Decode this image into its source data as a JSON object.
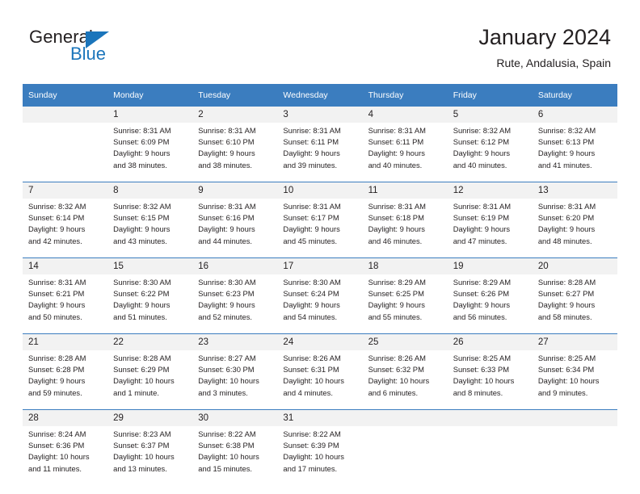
{
  "brand": {
    "name_part1": "General",
    "name_part2": "Blue",
    "triangle_color": "#1b75bb",
    "blue": "#1b75bb"
  },
  "header": {
    "title": "January 2024",
    "subtitle": "Rute, Andalusia, Spain"
  },
  "theme": {
    "header_bg": "#3b7dbf",
    "header_text": "#ffffff",
    "daynum_bg": "#f2f2f2",
    "divider": "#3b7dbf",
    "text": "#231f20"
  },
  "weekday_headers": [
    "Sunday",
    "Monday",
    "Tuesday",
    "Wednesday",
    "Thursday",
    "Friday",
    "Saturday"
  ],
  "weeks": [
    {
      "numbers": [
        "",
        "1",
        "2",
        "3",
        "4",
        "5",
        "6"
      ],
      "cells": [
        {
          "sunrise": "",
          "sunset": "",
          "daylight_line1": "",
          "daylight_line2": ""
        },
        {
          "sunrise": "Sunrise: 8:31 AM",
          "sunset": "Sunset: 6:09 PM",
          "daylight_line1": "Daylight: 9 hours",
          "daylight_line2": "and 38 minutes."
        },
        {
          "sunrise": "Sunrise: 8:31 AM",
          "sunset": "Sunset: 6:10 PM",
          "daylight_line1": "Daylight: 9 hours",
          "daylight_line2": "and 38 minutes."
        },
        {
          "sunrise": "Sunrise: 8:31 AM",
          "sunset": "Sunset: 6:11 PM",
          "daylight_line1": "Daylight: 9 hours",
          "daylight_line2": "and 39 minutes."
        },
        {
          "sunrise": "Sunrise: 8:31 AM",
          "sunset": "Sunset: 6:11 PM",
          "daylight_line1": "Daylight: 9 hours",
          "daylight_line2": "and 40 minutes."
        },
        {
          "sunrise": "Sunrise: 8:32 AM",
          "sunset": "Sunset: 6:12 PM",
          "daylight_line1": "Daylight: 9 hours",
          "daylight_line2": "and 40 minutes."
        },
        {
          "sunrise": "Sunrise: 8:32 AM",
          "sunset": "Sunset: 6:13 PM",
          "daylight_line1": "Daylight: 9 hours",
          "daylight_line2": "and 41 minutes."
        }
      ]
    },
    {
      "numbers": [
        "7",
        "8",
        "9",
        "10",
        "11",
        "12",
        "13"
      ],
      "cells": [
        {
          "sunrise": "Sunrise: 8:32 AM",
          "sunset": "Sunset: 6:14 PM",
          "daylight_line1": "Daylight: 9 hours",
          "daylight_line2": "and 42 minutes."
        },
        {
          "sunrise": "Sunrise: 8:32 AM",
          "sunset": "Sunset: 6:15 PM",
          "daylight_line1": "Daylight: 9 hours",
          "daylight_line2": "and 43 minutes."
        },
        {
          "sunrise": "Sunrise: 8:31 AM",
          "sunset": "Sunset: 6:16 PM",
          "daylight_line1": "Daylight: 9 hours",
          "daylight_line2": "and 44 minutes."
        },
        {
          "sunrise": "Sunrise: 8:31 AM",
          "sunset": "Sunset: 6:17 PM",
          "daylight_line1": "Daylight: 9 hours",
          "daylight_line2": "and 45 minutes."
        },
        {
          "sunrise": "Sunrise: 8:31 AM",
          "sunset": "Sunset: 6:18 PM",
          "daylight_line1": "Daylight: 9 hours",
          "daylight_line2": "and 46 minutes."
        },
        {
          "sunrise": "Sunrise: 8:31 AM",
          "sunset": "Sunset: 6:19 PM",
          "daylight_line1": "Daylight: 9 hours",
          "daylight_line2": "and 47 minutes."
        },
        {
          "sunrise": "Sunrise: 8:31 AM",
          "sunset": "Sunset: 6:20 PM",
          "daylight_line1": "Daylight: 9 hours",
          "daylight_line2": "and 48 minutes."
        }
      ]
    },
    {
      "numbers": [
        "14",
        "15",
        "16",
        "17",
        "18",
        "19",
        "20"
      ],
      "cells": [
        {
          "sunrise": "Sunrise: 8:31 AM",
          "sunset": "Sunset: 6:21 PM",
          "daylight_line1": "Daylight: 9 hours",
          "daylight_line2": "and 50 minutes."
        },
        {
          "sunrise": "Sunrise: 8:30 AM",
          "sunset": "Sunset: 6:22 PM",
          "daylight_line1": "Daylight: 9 hours",
          "daylight_line2": "and 51 minutes."
        },
        {
          "sunrise": "Sunrise: 8:30 AM",
          "sunset": "Sunset: 6:23 PM",
          "daylight_line1": "Daylight: 9 hours",
          "daylight_line2": "and 52 minutes."
        },
        {
          "sunrise": "Sunrise: 8:30 AM",
          "sunset": "Sunset: 6:24 PM",
          "daylight_line1": "Daylight: 9 hours",
          "daylight_line2": "and 54 minutes."
        },
        {
          "sunrise": "Sunrise: 8:29 AM",
          "sunset": "Sunset: 6:25 PM",
          "daylight_line1": "Daylight: 9 hours",
          "daylight_line2": "and 55 minutes."
        },
        {
          "sunrise": "Sunrise: 8:29 AM",
          "sunset": "Sunset: 6:26 PM",
          "daylight_line1": "Daylight: 9 hours",
          "daylight_line2": "and 56 minutes."
        },
        {
          "sunrise": "Sunrise: 8:28 AM",
          "sunset": "Sunset: 6:27 PM",
          "daylight_line1": "Daylight: 9 hours",
          "daylight_line2": "and 58 minutes."
        }
      ]
    },
    {
      "numbers": [
        "21",
        "22",
        "23",
        "24",
        "25",
        "26",
        "27"
      ],
      "cells": [
        {
          "sunrise": "Sunrise: 8:28 AM",
          "sunset": "Sunset: 6:28 PM",
          "daylight_line1": "Daylight: 9 hours",
          "daylight_line2": "and 59 minutes."
        },
        {
          "sunrise": "Sunrise: 8:28 AM",
          "sunset": "Sunset: 6:29 PM",
          "daylight_line1": "Daylight: 10 hours",
          "daylight_line2": "and 1 minute."
        },
        {
          "sunrise": "Sunrise: 8:27 AM",
          "sunset": "Sunset: 6:30 PM",
          "daylight_line1": "Daylight: 10 hours",
          "daylight_line2": "and 3 minutes."
        },
        {
          "sunrise": "Sunrise: 8:26 AM",
          "sunset": "Sunset: 6:31 PM",
          "daylight_line1": "Daylight: 10 hours",
          "daylight_line2": "and 4 minutes."
        },
        {
          "sunrise": "Sunrise: 8:26 AM",
          "sunset": "Sunset: 6:32 PM",
          "daylight_line1": "Daylight: 10 hours",
          "daylight_line2": "and 6 minutes."
        },
        {
          "sunrise": "Sunrise: 8:25 AM",
          "sunset": "Sunset: 6:33 PM",
          "daylight_line1": "Daylight: 10 hours",
          "daylight_line2": "and 8 minutes."
        },
        {
          "sunrise": "Sunrise: 8:25 AM",
          "sunset": "Sunset: 6:34 PM",
          "daylight_line1": "Daylight: 10 hours",
          "daylight_line2": "and 9 minutes."
        }
      ]
    },
    {
      "numbers": [
        "28",
        "29",
        "30",
        "31",
        "",
        "",
        ""
      ],
      "cells": [
        {
          "sunrise": "Sunrise: 8:24 AM",
          "sunset": "Sunset: 6:36 PM",
          "daylight_line1": "Daylight: 10 hours",
          "daylight_line2": "and 11 minutes."
        },
        {
          "sunrise": "Sunrise: 8:23 AM",
          "sunset": "Sunset: 6:37 PM",
          "daylight_line1": "Daylight: 10 hours",
          "daylight_line2": "and 13 minutes."
        },
        {
          "sunrise": "Sunrise: 8:22 AM",
          "sunset": "Sunset: 6:38 PM",
          "daylight_line1": "Daylight: 10 hours",
          "daylight_line2": "and 15 minutes."
        },
        {
          "sunrise": "Sunrise: 8:22 AM",
          "sunset": "Sunset: 6:39 PM",
          "daylight_line1": "Daylight: 10 hours",
          "daylight_line2": "and 17 minutes."
        },
        {
          "sunrise": "",
          "sunset": "",
          "daylight_line1": "",
          "daylight_line2": ""
        },
        {
          "sunrise": "",
          "sunset": "",
          "daylight_line1": "",
          "daylight_line2": ""
        },
        {
          "sunrise": "",
          "sunset": "",
          "daylight_line1": "",
          "daylight_line2": ""
        }
      ]
    }
  ]
}
